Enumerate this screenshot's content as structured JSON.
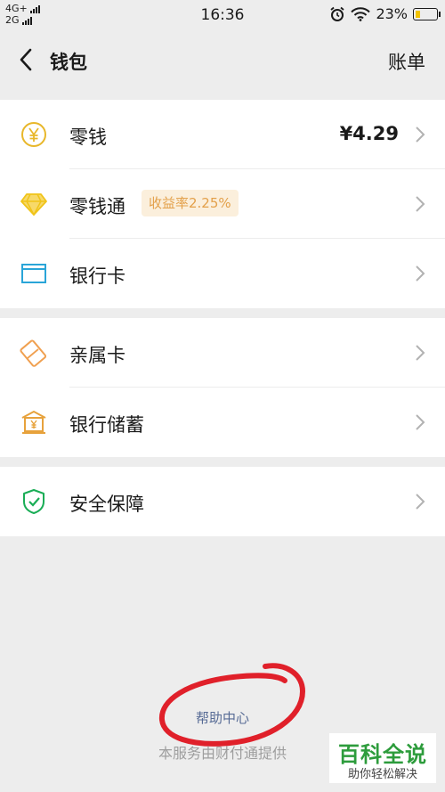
{
  "status_bar": {
    "network_top": "4G+",
    "network_bottom": "2G",
    "time": "16:36",
    "battery": "23%",
    "battery_level": 0.23
  },
  "nav": {
    "title": "钱包",
    "right_action": "账单"
  },
  "groups": [
    [
      {
        "label": "零钱",
        "value": "¥4.29",
        "icon": "coin-icon",
        "color": "#e8b72a"
      },
      {
        "label": "零钱通",
        "badge": "收益率2.25%",
        "icon": "diamond-icon",
        "color": "#f0c419"
      },
      {
        "label": "银行卡",
        "icon": "card-icon",
        "color": "#2aa5d8"
      }
    ],
    [
      {
        "label": "亲属卡",
        "icon": "family-card-icon",
        "color": "#f0a050"
      },
      {
        "label": "银行储蓄",
        "icon": "bank-icon",
        "color": "#e7a23c"
      }
    ],
    [
      {
        "label": "安全保障",
        "icon": "shield-icon",
        "color": "#1aad56"
      }
    ]
  ],
  "footer": {
    "help": "帮助中心",
    "provider": "本服务由财付通提供"
  },
  "watermark": {
    "title": "百科全说",
    "subtitle": "助你轻松解决"
  },
  "colors": {
    "background": "#ededed",
    "link": "#576b95",
    "annotation_circle": "#e0202a",
    "watermark_green": "#2d9c3c"
  }
}
